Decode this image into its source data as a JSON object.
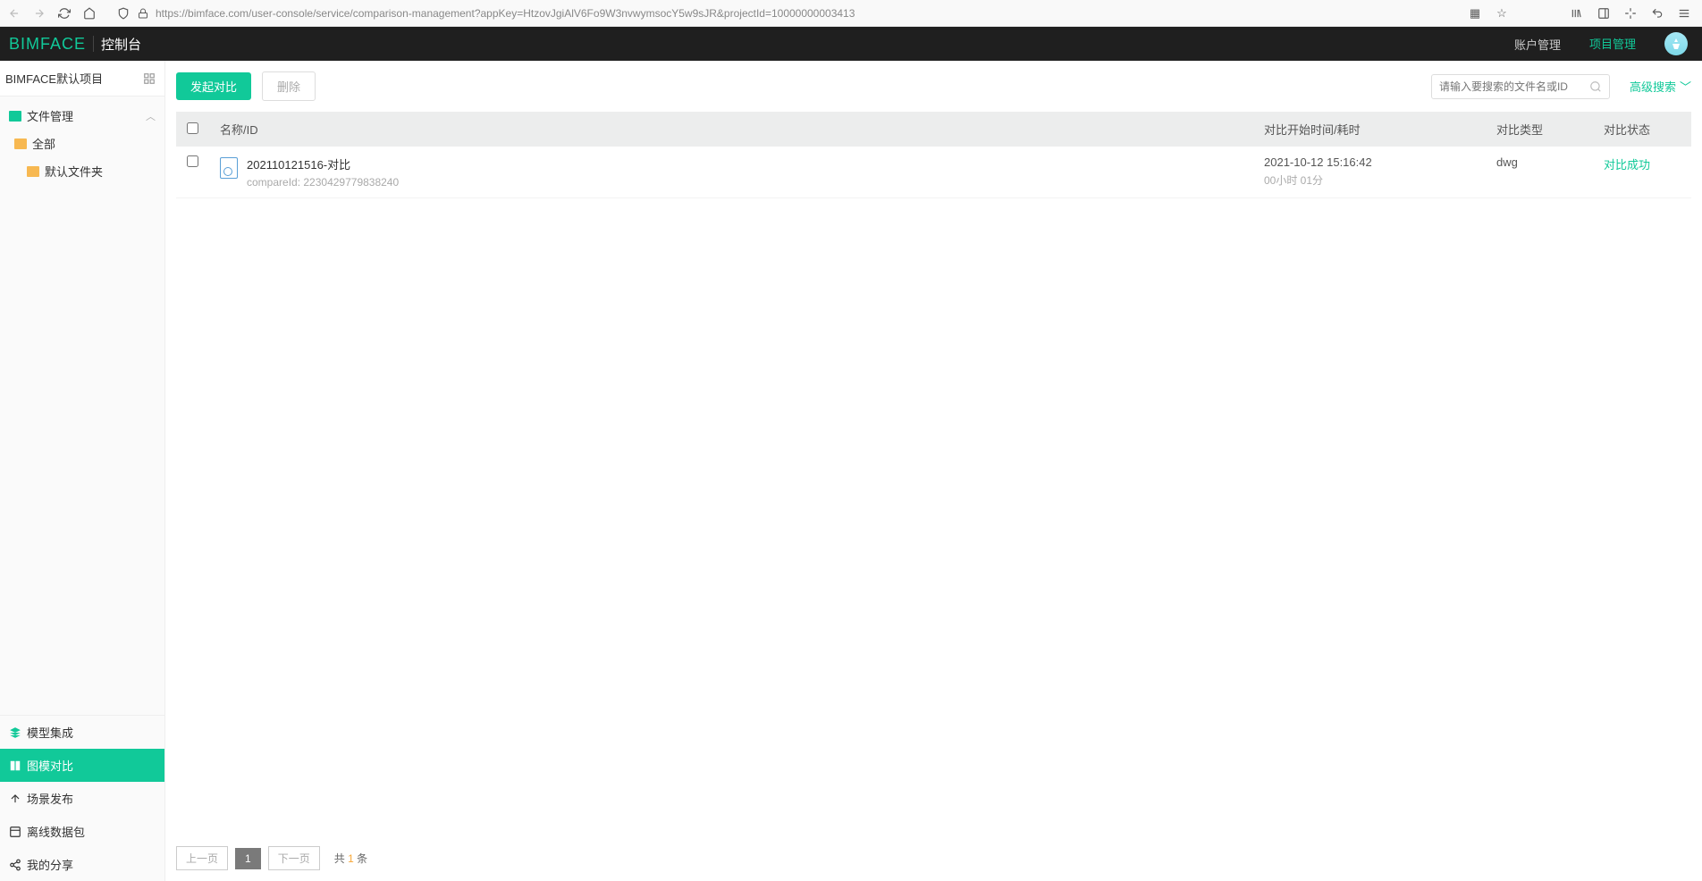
{
  "browser": {
    "url": "https://bimface.com/user-console/service/comparison-management?appKey=HtzovJgiAlV6Fo9W3nvwymsocY5w9sJR&projectId=10000000003413"
  },
  "header": {
    "logo_main": "BIMFACE",
    "logo_sub": "控制台",
    "nav": {
      "account": "账户管理",
      "project": "项目管理"
    }
  },
  "sidebar": {
    "project_name": "BIMFACE默认项目",
    "file_manage": "文件管理",
    "tree": {
      "all": "全部",
      "default_folder": "默认文件夹"
    },
    "menu": {
      "model_integration": "模型集成",
      "compare": "图模对比",
      "scene_publish": "场景发布",
      "offline_package": "离线数据包",
      "my_share": "我的分享"
    }
  },
  "actions": {
    "start_compare": "发起对比",
    "delete": "删除",
    "search_placeholder": "请输入要搜索的文件名或ID",
    "adv_search": "高级搜索"
  },
  "table": {
    "headers": {
      "name": "名称/ID",
      "start_time": "对比开始时间/耗时",
      "type": "对比类型",
      "status": "对比状态"
    },
    "rows": [
      {
        "name": "202110121516-对比",
        "compare_label": "compareId: ",
        "compare_id": "2230429779838240",
        "start_time": "2021-10-12 15:16:42",
        "duration": "00小时 01分",
        "type": "dwg",
        "status": "对比成功"
      }
    ]
  },
  "pagination": {
    "prev": "上一页",
    "current": "1",
    "next": "下一页",
    "total_prefix": "共 ",
    "total_count": "1",
    "total_suffix": " 条"
  }
}
